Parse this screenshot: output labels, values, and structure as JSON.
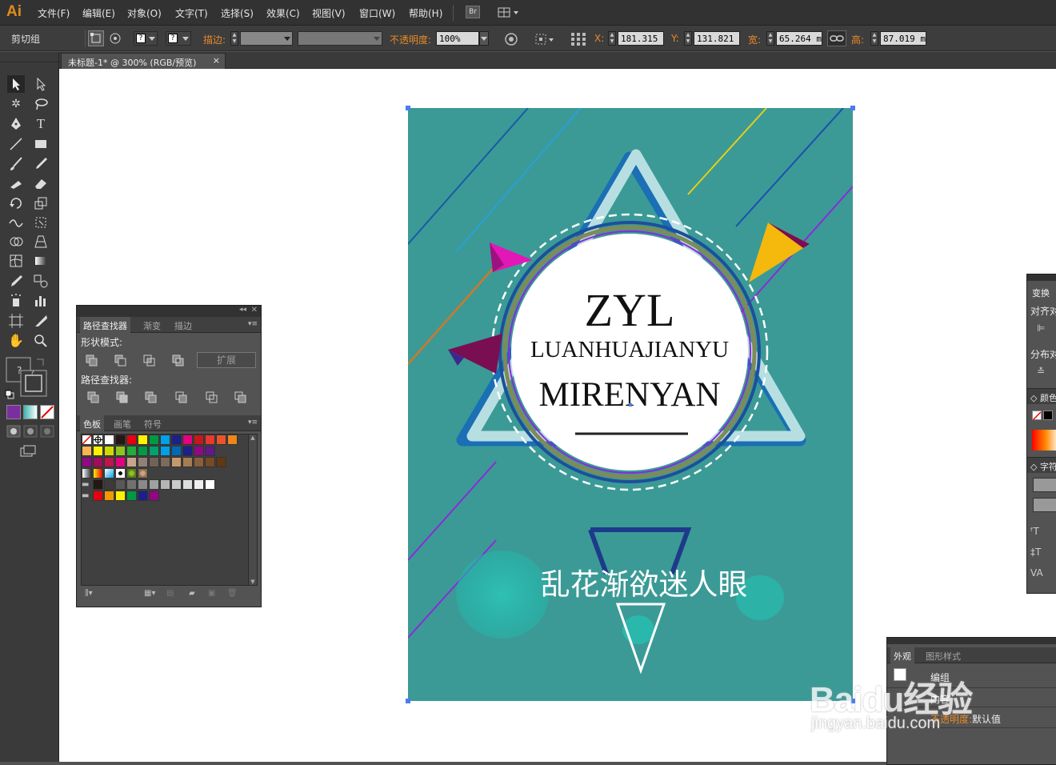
{
  "app": {
    "logo": "Ai",
    "logo_color": "#e38a1b"
  },
  "menu": [
    "文件(F)",
    "编辑(E)",
    "对象(O)",
    "文字(T)",
    "选择(S)",
    "效果(C)",
    "视图(V)",
    "窗口(W)",
    "帮助(H)"
  ],
  "menu_extra": {
    "bridge_label": "Br"
  },
  "control_bar": {
    "selection_label": "剪切组",
    "stroke_label": "描边:",
    "opacity_label": "不透明度:",
    "opacity_value": "100%",
    "x_label": "X:",
    "x_value": "181.315 r",
    "y_label": "Y:",
    "y_value": "131.821 r",
    "w_label": "宽:",
    "w_value": "65.264 mi",
    "h_label": "高:",
    "h_value": "87.019 mi"
  },
  "document_tab": {
    "title": "未标题-1* @ 300% (RGB/预览)",
    "close": "×"
  },
  "pathfinder_panel": {
    "tabs": [
      "路径查找器",
      "渐变",
      "描边"
    ],
    "shape_modes_label": "形状模式:",
    "expand_button": "扩展",
    "pathfinders_label": "路径查找器:"
  },
  "swatches_panel": {
    "tabs": [
      "色板",
      "画笔",
      "符号"
    ],
    "rows": [
      [
        "none",
        "#ffffff",
        "#ffffff",
        "#231815",
        "#e60012",
        "#fff100",
        "#009944",
        "#00a0e9",
        "#1d2088",
        "#e4007f",
        "#c9161d",
        "#e8382f",
        "#e9542c",
        "#f08519"
      ],
      [
        "#f8b551",
        "#fff100",
        "#cfdb00",
        "#8fc31f",
        "#22ac38",
        "#009944",
        "#00a16c",
        "#00a0e9",
        "#0068b7",
        "#1d2088",
        "#920783",
        "#601986"
      ],
      [
        "#920783",
        "#a40b5d",
        "#c0144a",
        "#e4007f",
        "#c9a48a",
        "#8f8178",
        "#6f6259",
        "#7c6a5a",
        "#c49a6c",
        "#a67c52",
        "#8b5e3c",
        "#754c24",
        "#603813"
      ],
      [
        "grad-gray",
        "grad-orange",
        "grad-blue",
        "pattern-dots",
        "pattern-green",
        "pattern-tan"
      ],
      [
        "#231815",
        "#3e3a39",
        "#595757",
        "#727171",
        "#898989",
        "#9fa0a0",
        "#b5b5b6",
        "#c9caca",
        "#dcdddd",
        "#efefef",
        "#ffffff"
      ],
      [
        "#e60012",
        "#f39800",
        "#fff100",
        "#009944",
        "#1d2088",
        "#920783"
      ]
    ]
  },
  "right_panels": {
    "transform_tab": "变换",
    "align_label": "对齐对",
    "distribute_label": "分布对",
    "color_label": "颜色",
    "char_label": "字符"
  },
  "appearance_panel": {
    "tabs": [
      "外观",
      "图形样式"
    ],
    "group_label": "编组",
    "content_label": "内容",
    "opacity_label": "不透明度:",
    "opacity_value": "默认值"
  },
  "artwork": {
    "background": "#3b9a96",
    "title_main": "ZYL",
    "title_sub1": "LUANHUAJIANYU",
    "title_sub2": "MIRENYAN",
    "slogan": "乱花渐欲迷人眼"
  },
  "watermark": {
    "brand": "Baidu经验",
    "url": "jingyan.baidu.com"
  }
}
